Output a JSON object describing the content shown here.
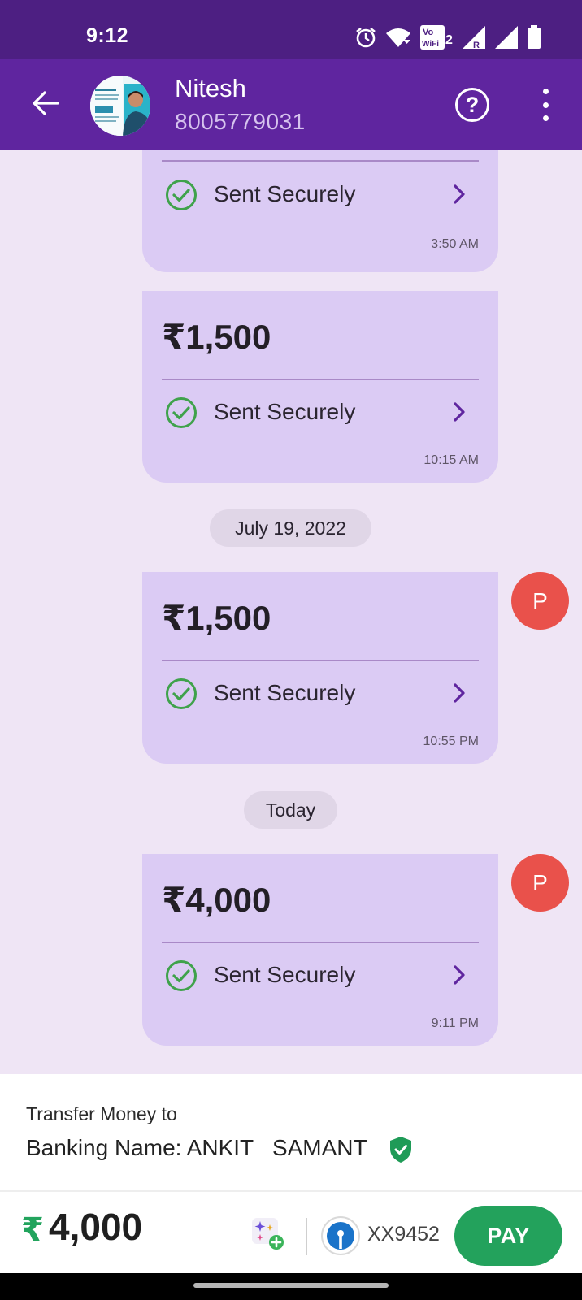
{
  "status_bar": {
    "time": "9:12",
    "icons": [
      "alarm-icon",
      "wifi-icon",
      "vowifi-icon",
      "signal-r-icon",
      "signal-icon",
      "battery-icon"
    ],
    "vowifi_text": "Vo WiFi 2"
  },
  "header": {
    "name": "Nitesh",
    "phone": "8005779031",
    "help_symbol": "?"
  },
  "messages": [
    {
      "amount": "",
      "status": "Sent Securely",
      "time": "3:50 AM"
    },
    {
      "amount": "₹1,500",
      "status": "Sent Securely",
      "time": "10:15 AM"
    },
    {
      "amount": "₹1,500",
      "status": "Sent Securely",
      "time": "10:55 PM",
      "sender_initial": "P"
    },
    {
      "amount": "₹4,000",
      "status": "Sent Securely",
      "time": "9:11 PM",
      "sender_initial": "P"
    }
  ],
  "date_separators": [
    "July 19, 2022",
    "Today"
  ],
  "transfer": {
    "title": "Transfer Money to",
    "banking_name": "Banking Name: ANKIT   SAMANT"
  },
  "paybar": {
    "currency": "₹",
    "amount": "4,000",
    "account": "XX9452",
    "pay_label": "PAY"
  },
  "colors": {
    "header": "#5f259f",
    "status_bar": "#4d1f82",
    "bubble": "#dbcbf4",
    "chat_bg": "#efe5f5",
    "pay": "#23a25c",
    "sender_avatar": "#e9514b",
    "check": "#3fa24b"
  }
}
